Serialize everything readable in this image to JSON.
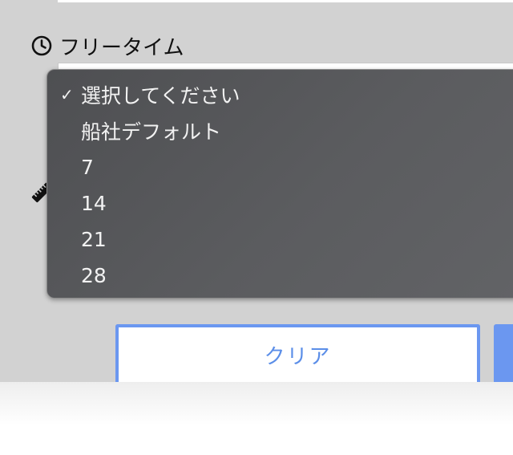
{
  "field": {
    "label": "フリータイム",
    "icon": "clock-icon"
  },
  "dropdown": {
    "check_mark": "✓",
    "selected_index": 0,
    "options": [
      "選択してください",
      "船社デフォルト",
      "7",
      "14",
      "21",
      "28"
    ]
  },
  "buttons": {
    "clear_label": "クリア"
  },
  "colors": {
    "accent": "#6b97f0",
    "accent_text": "#5b8ee8",
    "menu_bg": "#58595c",
    "overlay": "#d2d2d2"
  }
}
